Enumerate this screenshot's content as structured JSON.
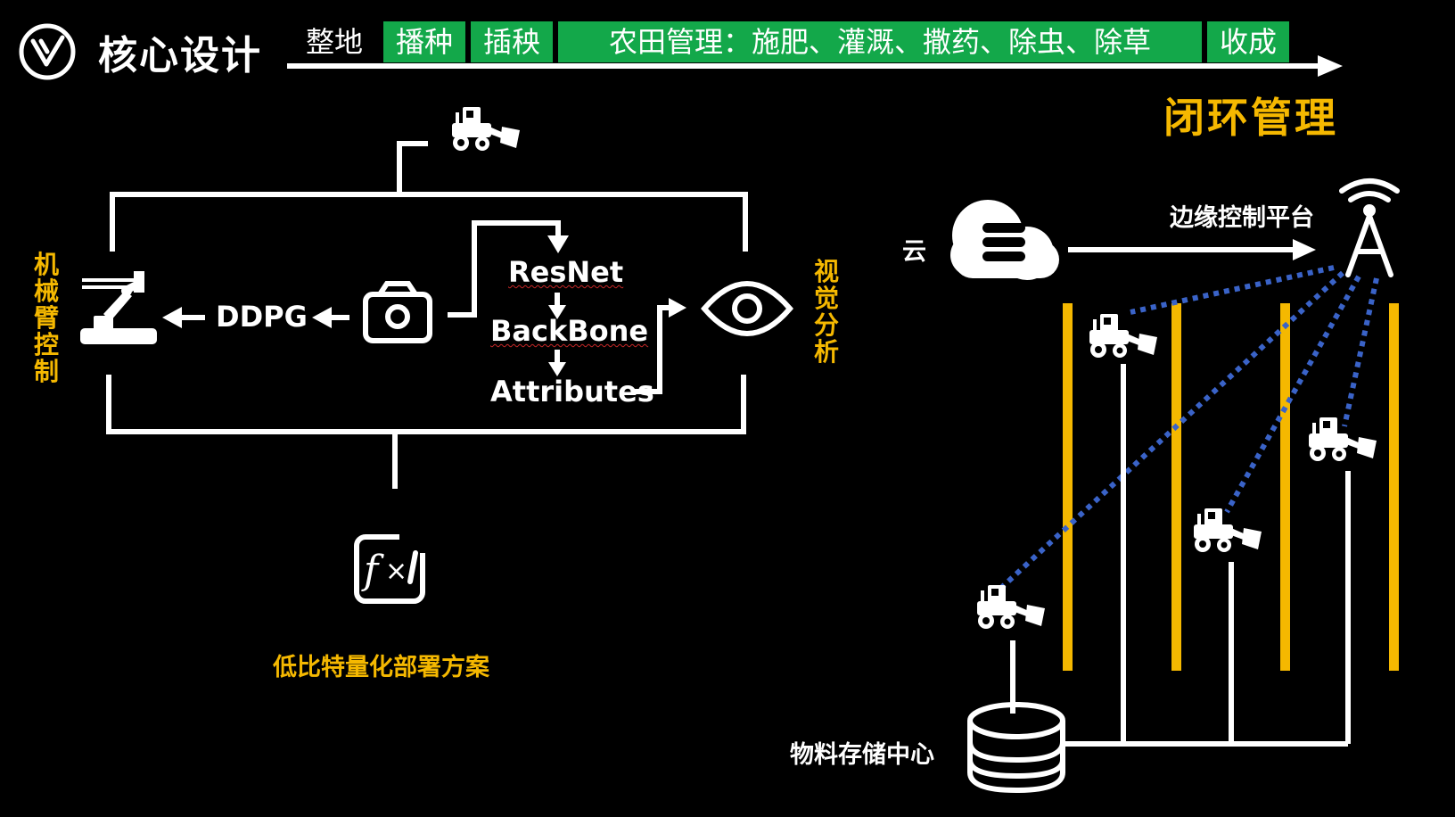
{
  "header": {
    "logo_name": "v-logo-icon",
    "title": "核心设计",
    "stages": [
      {
        "label": "整地",
        "highlighted": false
      },
      {
        "label": "播种",
        "highlighted": true
      },
      {
        "label": "插秧",
        "highlighted": true
      },
      {
        "label": "农田管理：施肥、灌溉、撒药、除虫、除草",
        "highlighted": true
      },
      {
        "label": "收成",
        "highlighted": true
      }
    ],
    "closed_loop_label": "闭环管理"
  },
  "left_diagram": {
    "arm_label": "机械臂控制",
    "vision_label": "视觉分析",
    "ddpg_label": "DDPG",
    "pipeline": [
      "ResNet",
      "BackBone",
      "Attributes"
    ],
    "quant_label": "低比特量化部署方案"
  },
  "right_diagram": {
    "cloud_label": "云",
    "edge_label": "边缘控制平台",
    "storage_label": "物料存储中心"
  },
  "colors": {
    "accent_yellow": "#f5b800",
    "stage_green": "#13a84a",
    "link_blue": "#3a63c8",
    "background": "#000000"
  }
}
